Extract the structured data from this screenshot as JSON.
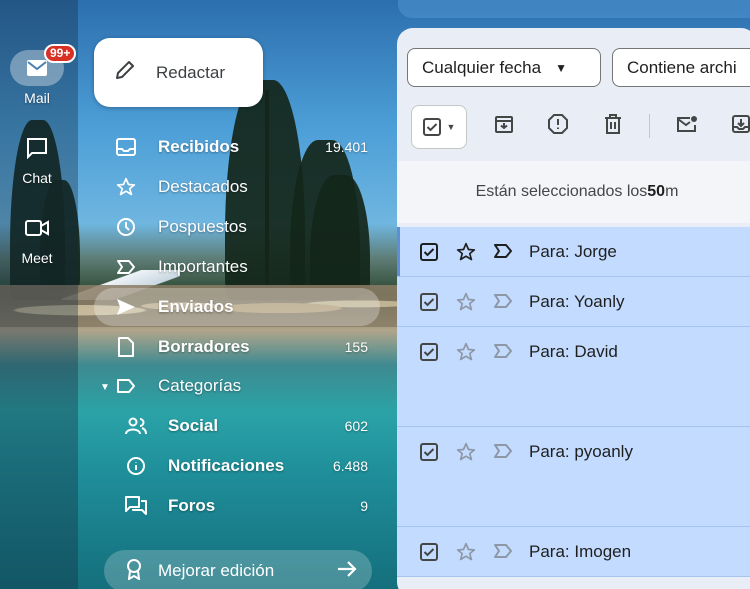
{
  "rail": {
    "mail": {
      "label": "Mail",
      "badge": "99+"
    },
    "chat": {
      "label": "Chat"
    },
    "meet": {
      "label": "Meet"
    }
  },
  "compose": {
    "label": "Redactar"
  },
  "nav": {
    "inbox": {
      "label": "Recibidos",
      "count": "19.401"
    },
    "starred": {
      "label": "Destacados"
    },
    "snoozed": {
      "label": "Pospuestos"
    },
    "important": {
      "label": "Importantes"
    },
    "sent": {
      "label": "Enviados"
    },
    "drafts": {
      "label": "Borradores",
      "count": "155"
    },
    "categories": {
      "label": "Categorías"
    },
    "social": {
      "label": "Social",
      "count": "602"
    },
    "updates": {
      "label": "Notificaciones",
      "count": "6.488"
    },
    "forums": {
      "label": "Foros",
      "count": "9"
    }
  },
  "upgrade": {
    "label": "Mejorar edición"
  },
  "filters": {
    "date": {
      "label": "Cualquier fecha"
    },
    "attachment": {
      "label": "Contiene archi"
    }
  },
  "banner": {
    "prefix": "Están seleccionados los ",
    "count": "50",
    "suffix": " m"
  },
  "emails": [
    {
      "to": "Para: Jorge"
    },
    {
      "to": "Para: Yoanly"
    },
    {
      "to": "Para: David"
    },
    {
      "to": "Para: pyoanly"
    },
    {
      "to": "Para: Imogen"
    }
  ],
  "colors": {
    "accent": "#0b57d0",
    "selected_row": "#c2dbff",
    "badge": "#d93025"
  }
}
